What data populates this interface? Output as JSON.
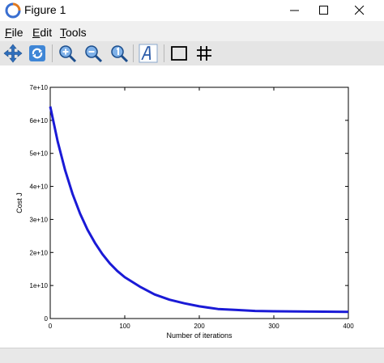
{
  "window": {
    "title": "Figure 1"
  },
  "menu": {
    "items": [
      {
        "underline": "F",
        "rest": "ile"
      },
      {
        "underline": "E",
        "rest": "dit"
      },
      {
        "underline": "T",
        "rest": "ools"
      }
    ]
  },
  "toolbar": {
    "buttons": [
      "pan-icon",
      "rotate-icon",
      "zoom-in-icon",
      "zoom-out-icon",
      "zoom-reset-icon",
      "text-insert-icon",
      "axes-box-icon",
      "grid-icon"
    ]
  },
  "colors": {
    "line": "#1a1ad6",
    "axis": "#000000"
  },
  "chart_data": {
    "type": "line",
    "title": "",
    "xlabel": "Number of iterations",
    "ylabel": "Cost J",
    "xlim": [
      0,
      400
    ],
    "ylim": [
      0,
      70000000000
    ],
    "xticks": [
      0,
      100,
      200,
      300,
      400
    ],
    "xtick_labels": [
      "0",
      "100",
      "200",
      "300",
      "400"
    ],
    "yticks": [
      0,
      10000000000,
      20000000000,
      30000000000,
      40000000000,
      50000000000,
      60000000000,
      70000000000
    ],
    "ytick_labels": [
      "0",
      "1e+10",
      "2e+10",
      "3e+10",
      "4e+10",
      "5e+10",
      "6e+10",
      "7e+10"
    ],
    "grid": false,
    "series": [
      {
        "x": [
          0,
          10,
          20,
          30,
          40,
          50,
          60,
          70,
          80,
          90,
          100,
          120,
          140,
          160,
          180,
          200,
          225,
          250,
          275,
          300,
          350,
          400
        ],
        "values": [
          64200000000,
          53600000000,
          44900000000,
          37700000000,
          31800000000,
          26900000000,
          22900000000,
          19500000000,
          16700000000,
          14400000000,
          12500000000,
          9700000000,
          7300000000,
          5700000000,
          4600000000,
          3700000000,
          2900000000,
          2600000000,
          2300000000,
          2200000000,
          2100000000,
          2000000000
        ]
      }
    ]
  }
}
